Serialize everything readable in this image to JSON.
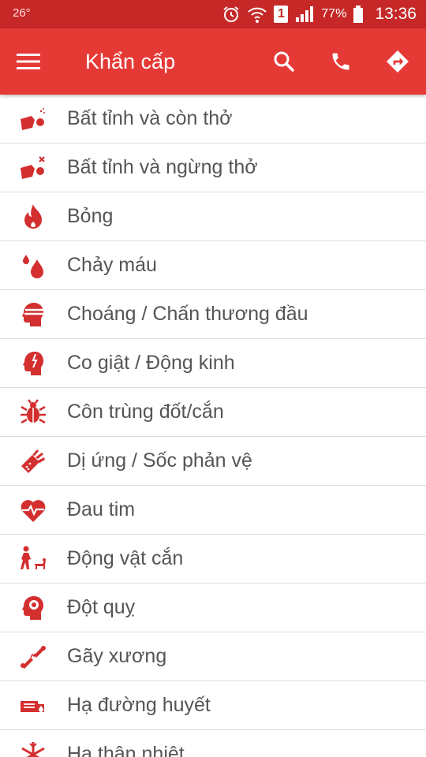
{
  "status_bar": {
    "temperature": "26°",
    "sim_slot": "1",
    "battery": "77%",
    "time": "13:36"
  },
  "app_bar": {
    "title": "Khẩn cấp",
    "icons": [
      "menu-icon",
      "search-icon",
      "phone-icon",
      "directions-icon"
    ]
  },
  "colors": {
    "status_bar": "#c62828",
    "app_bar": "#e53935",
    "icon_red": "#d32f2f",
    "label_text": "#555555",
    "divider": "#dcdcdc"
  },
  "items": [
    {
      "label": "Bất tỉnh và còn thở",
      "icon": "unconscious-breathing-icon"
    },
    {
      "label": "Bất tỉnh và ngừng thở",
      "icon": "unconscious-not-breathing-icon"
    },
    {
      "label": "Bỏng",
      "icon": "fire-icon"
    },
    {
      "label": "Chảy máu",
      "icon": "blood-drop-icon"
    },
    {
      "label": "Choáng / Chấn thương đầu",
      "icon": "head-injury-icon"
    },
    {
      "label": "Co giật / Động kinh",
      "icon": "seizure-head-icon"
    },
    {
      "label": "Côn trùng đốt/cắn",
      "icon": "insect-icon"
    },
    {
      "label": "Dị ứng / Sốc phản vệ",
      "icon": "allergy-icon"
    },
    {
      "label": "Đau tim",
      "icon": "heart-pulse-icon"
    },
    {
      "label": "Động vật cắn",
      "icon": "animal-bite-icon"
    },
    {
      "label": "Đột quỵ",
      "icon": "stroke-head-icon"
    },
    {
      "label": "Gãy xương",
      "icon": "broken-bone-icon"
    },
    {
      "label": "Hạ đường huyết",
      "icon": "low-blood-sugar-icon"
    },
    {
      "label": "Hạ thân nhiệt",
      "icon": "snowflake-icon"
    }
  ]
}
